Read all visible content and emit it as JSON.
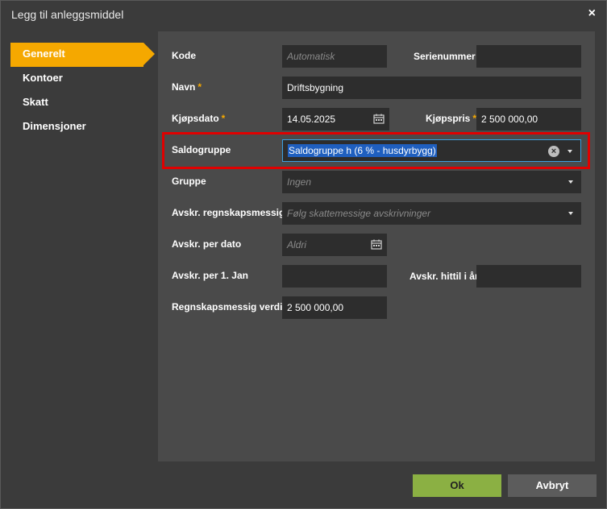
{
  "dialog": {
    "title": "Legg til anleggsmiddel",
    "close": "×"
  },
  "sidebar": {
    "items": [
      {
        "label": "Generelt"
      },
      {
        "label": "Kontoer"
      },
      {
        "label": "Skatt"
      },
      {
        "label": "Dimensjoner"
      }
    ]
  },
  "form": {
    "kode": {
      "label": "Kode",
      "placeholder": "Automatisk"
    },
    "serienummer": {
      "label": "Serienummer",
      "value": ""
    },
    "navn": {
      "label": "Navn",
      "req": "*",
      "value": "Driftsbygning"
    },
    "kjopsdato": {
      "label": "Kjøpsdato",
      "req": "*",
      "value": "14.05.2025"
    },
    "kjopspris": {
      "label": "Kjøpspris",
      "req": "*",
      "value": "2 500 000,00"
    },
    "saldogruppe": {
      "label": "Saldogruppe",
      "value": "Saldogruppe h (6 % - husdyrbygg)"
    },
    "gruppe": {
      "label": "Gruppe",
      "placeholder": "Ingen"
    },
    "avskr_regnskap": {
      "label": "Avskr. regnskapsmessig",
      "placeholder": "Følg skattemessige avskrivninger"
    },
    "avskr_per_dato": {
      "label": "Avskr. per dato",
      "placeholder": "Aldri"
    },
    "avskr_per_jan": {
      "label": "Avskr. per 1. Jan",
      "value": ""
    },
    "avskr_hittil": {
      "label": "Avskr. hittil i år",
      "value": ""
    },
    "regnskapsmessig_verdi": {
      "label": "Regnskapsmessig verdi",
      "value": "2 500 000,00"
    }
  },
  "buttons": {
    "ok": "Ok",
    "cancel": "Avbryt"
  },
  "colors": {
    "accent": "#f5a800",
    "ok": "#8bb043",
    "highlight": "#e00000"
  }
}
